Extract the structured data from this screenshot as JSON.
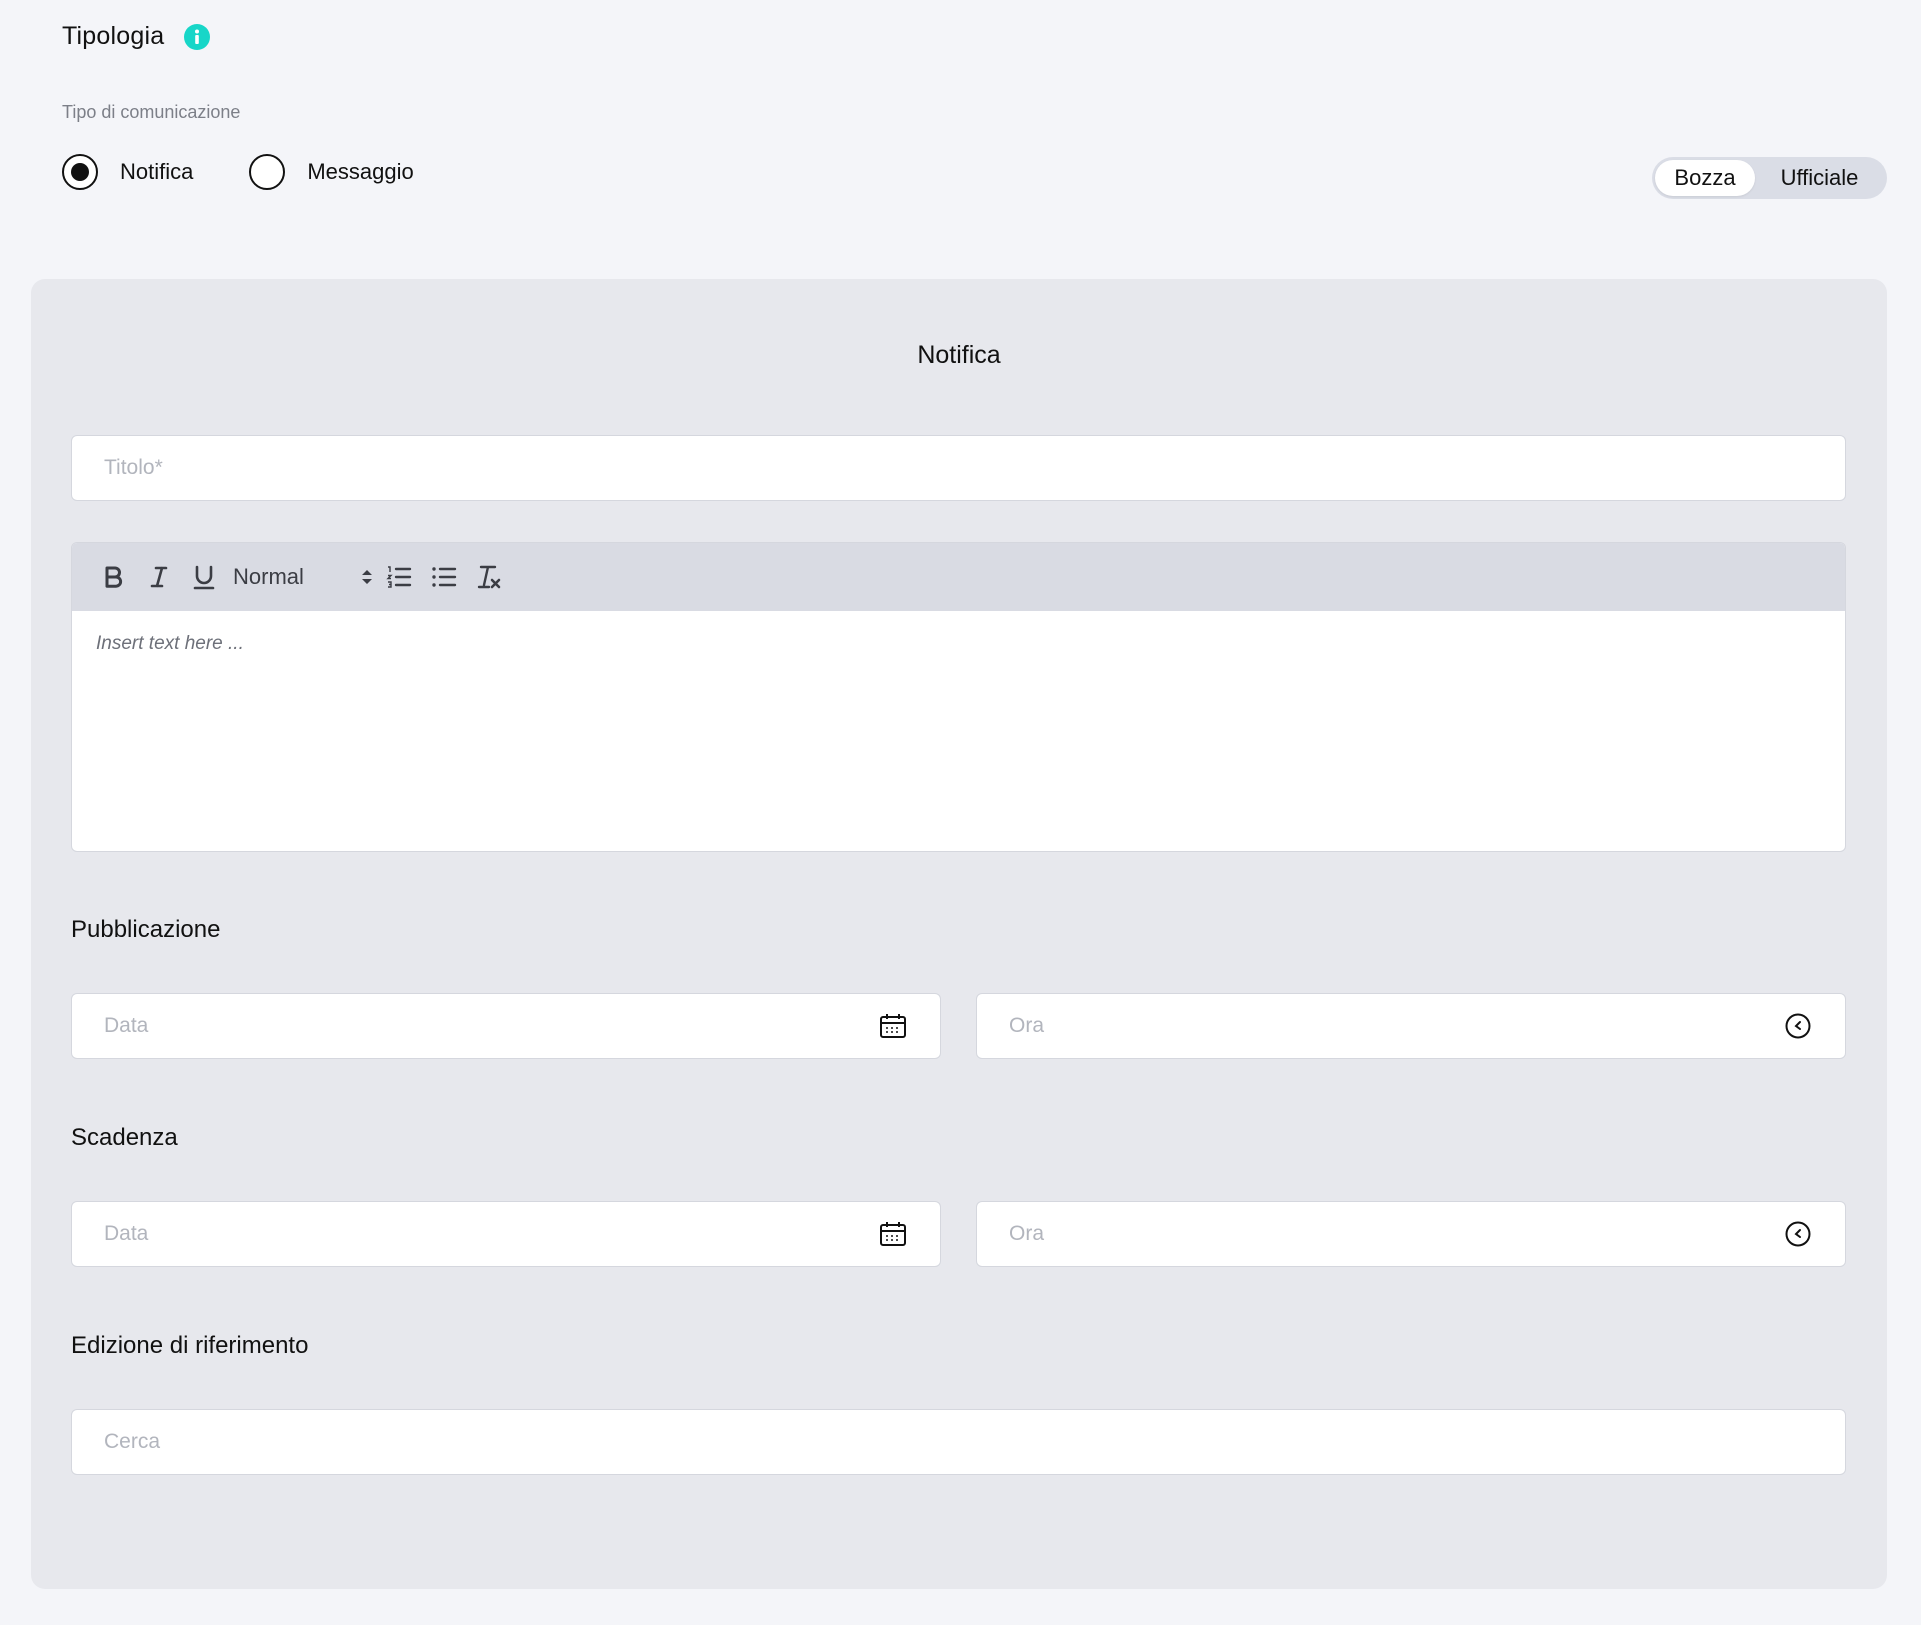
{
  "header": {
    "title": "Tipologia",
    "info_icon": "info-icon",
    "accent_color": "#17d6c8"
  },
  "type_selector": {
    "label": "Tipo di comunicazione",
    "options": [
      {
        "label": "Notifica",
        "selected": true
      },
      {
        "label": "Messaggio",
        "selected": false
      }
    ]
  },
  "status_toggle": {
    "options": [
      "Bozza",
      "Ufficiale"
    ],
    "active": "Bozza"
  },
  "form": {
    "title": "Notifica",
    "title_field": {
      "placeholder": "Titolo*"
    },
    "editor": {
      "toolbar": {
        "bold": "bold-icon",
        "italic": "italic-icon",
        "underline": "underline-icon",
        "format_value": "Normal",
        "ordered_list": "ordered-list-icon",
        "bullet_list": "bullet-list-icon",
        "clear_format": "clear-format-icon"
      },
      "placeholder": "Insert text here ..."
    },
    "publication": {
      "heading": "Pubblicazione",
      "date_placeholder": "Data",
      "time_placeholder": "Ora"
    },
    "expiry": {
      "heading": "Scadenza",
      "date_placeholder": "Data",
      "time_placeholder": "Ora"
    },
    "edition": {
      "heading": "Edizione di riferimento",
      "search_placeholder": "Cerca"
    }
  }
}
